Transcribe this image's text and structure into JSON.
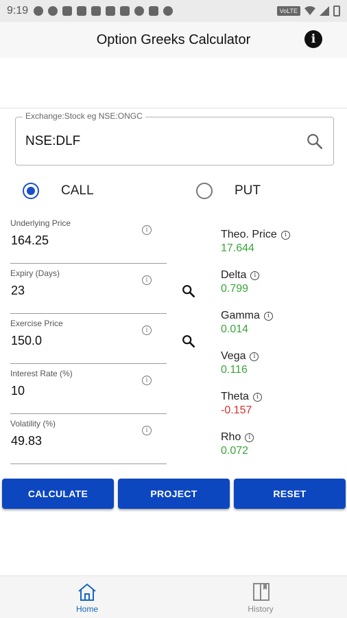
{
  "status_bar": {
    "time": "9:19",
    "network": "VoLTE"
  },
  "app_bar": {
    "title": "Option Greeks Calculator",
    "info_icon": "info-icon"
  },
  "exchange": {
    "label": "Exchange:Stock eg NSE:ONGC",
    "value": "NSE:DLF",
    "icon": "search-icon"
  },
  "option_type": {
    "call_label": "CALL",
    "put_label": "PUT",
    "selected": "CALL"
  },
  "inputs": {
    "underlying_price": {
      "label": "Underlying Price",
      "value": "164.25"
    },
    "expiry": {
      "label": "Expiry (Days)",
      "value": "23"
    },
    "exercise_price": {
      "label": "Exercise Price",
      "value": "150.0"
    },
    "interest_rate": {
      "label": "Interest Rate (%)",
      "value": "10"
    },
    "volatility": {
      "label": "Volatility (%)",
      "value": "49.83"
    }
  },
  "results": {
    "theo_price": {
      "label": "Theo. Price",
      "value": "17.644"
    },
    "delta": {
      "label": "Delta",
      "value": "0.799"
    },
    "gamma": {
      "label": "Gamma",
      "value": "0.014"
    },
    "vega": {
      "label": "Vega",
      "value": "0.116"
    },
    "theta": {
      "label": "Theta",
      "value": "-0.157"
    },
    "rho": {
      "label": "Rho",
      "value": "0.072"
    }
  },
  "buttons": {
    "calculate": "CALCULATE",
    "project": "PROJECT",
    "reset": "RESET"
  },
  "bottom_nav": {
    "home": "Home",
    "history": "History",
    "active": "Home"
  },
  "colors": {
    "accent": "#0d47c0",
    "radio_selected": "#1a4fc9",
    "positive": "#3aa63a",
    "negative": "#d32f2f",
    "nav_active": "#1565c0",
    "nav_inactive": "#888888"
  }
}
